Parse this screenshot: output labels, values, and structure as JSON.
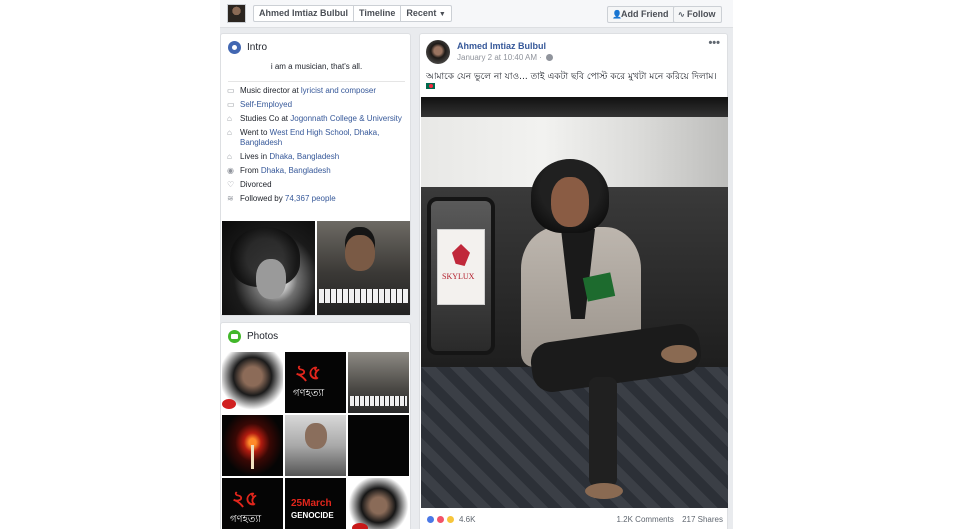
{
  "header": {
    "profile_name": "Ahmed Imtiaz Bulbul",
    "timeline_label": "Timeline",
    "recent_label": "Recent",
    "add_friend_label": "Add Friend",
    "follow_label": "Follow"
  },
  "intro": {
    "title": "Intro",
    "bio": "i am a musician, that's all.",
    "items": [
      {
        "icon": "briefcase-icon",
        "text": "Music director at ",
        "link": "lyricist and composer"
      },
      {
        "icon": "briefcase-icon",
        "text": "",
        "link": "Self-Employed"
      },
      {
        "icon": "graduation-cap-icon",
        "text": "Studies Co at ",
        "link": "Jogonnath College & University"
      },
      {
        "icon": "graduation-cap-icon",
        "text": "Went to ",
        "link": "West End High School, Dhaka, Bangladesh"
      },
      {
        "icon": "house-icon",
        "text": "Lives in ",
        "link": "Dhaka, Bangladesh"
      },
      {
        "icon": "location-pin-icon",
        "text": "From ",
        "link": "Dhaka, Bangladesh"
      },
      {
        "icon": "heart-icon",
        "text": "Divorced",
        "link": ""
      },
      {
        "icon": "rss-icon",
        "text": "Followed by ",
        "link": "74,367 people"
      }
    ]
  },
  "photos": {
    "title": "Photos"
  },
  "post": {
    "author": "Ahmed Imtiaz Bulbul",
    "date": "January 2 at 10:40 AM",
    "text": "আমাকে যেন ভুলে না যাও... তাই একটা ছবি পোস্ট করে মুখটা মনে করিয়ে দিলাম।",
    "more_label": "•••",
    "reaction_count": "4.6K",
    "comments": "1.2K Comments",
    "shares": "217 Shares"
  },
  "colors": {
    "link": "#365899",
    "page_bg": "#e9ebee",
    "card_border": "#dddfe2"
  }
}
